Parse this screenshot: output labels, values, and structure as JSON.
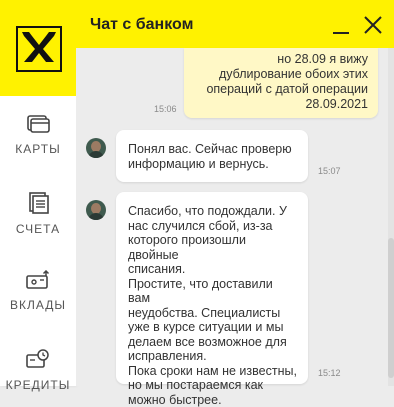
{
  "sidebar": {
    "logo_icon": "raiffeisen-logo-icon",
    "items": [
      {
        "label": "КАРТЫ",
        "icon": "card-icon"
      },
      {
        "label": "СЧЕТА",
        "icon": "accounts-icon"
      },
      {
        "label": "ВКЛАДЫ",
        "icon": "deposit-icon"
      },
      {
        "label": "КРЕДИТЫ",
        "icon": "credit-icon"
      }
    ]
  },
  "chat": {
    "title": "Чат с банком",
    "minimize_icon": "minimize-icon",
    "close_icon": "close-icon",
    "messages": [
      {
        "from": "user",
        "text": "но 28.09 я вижу\nдублирование обоих этих\nопераций с датой операции\n28.09.2021",
        "time": "15:06"
      },
      {
        "from": "bank",
        "text": "Понял вас. Сейчас проверю\nинформацию и вернусь.",
        "time": "15:07"
      },
      {
        "from": "bank",
        "text": "Спасибо, что подождали. У\nнас случился сбой, из-за\nкоторого произошли двойные\nсписания.\nПростите, что доставили вам\nнеудобства. Специалисты\nуже в курсе ситуации и мы\nделаем все возможное для\nисправления.\nПока сроки нам не известны,\nно мы постараемся как\nможно быстрее.",
        "time": "15:12"
      }
    ]
  },
  "colors": {
    "brand_yellow": "#fff200",
    "outgoing_bubble": "#fff8c6",
    "incoming_bubble": "#ffffff",
    "background": "#ececec"
  }
}
